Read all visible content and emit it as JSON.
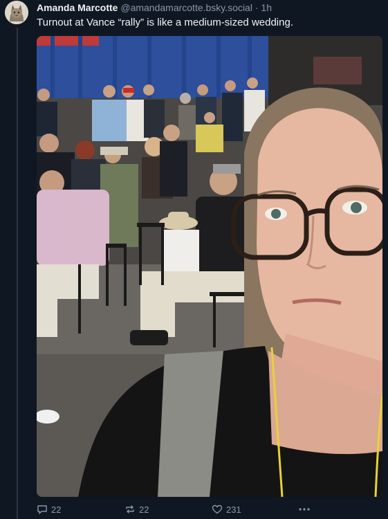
{
  "post": {
    "author_name": "Amanda Marcotte",
    "author_handle": "@amandamarcotte.bsky.social",
    "separator": "·",
    "time_ago": "1h",
    "text": "Turnout at Vance “rally” is like a medium-sized wedding."
  },
  "media": {
    "image_description": "selfie-at-event"
  },
  "actions": {
    "reply_count": "22",
    "repost_count": "22",
    "like_count": "231",
    "reply_icon": "speech-bubble-icon",
    "repost_icon": "repost-arrows-icon",
    "like_icon": "heart-outline-icon",
    "more_icon": "ellipsis-icon"
  },
  "colors": {
    "background": "#0f1722",
    "name": "#f1f3f5",
    "muted": "#8a98a8"
  }
}
